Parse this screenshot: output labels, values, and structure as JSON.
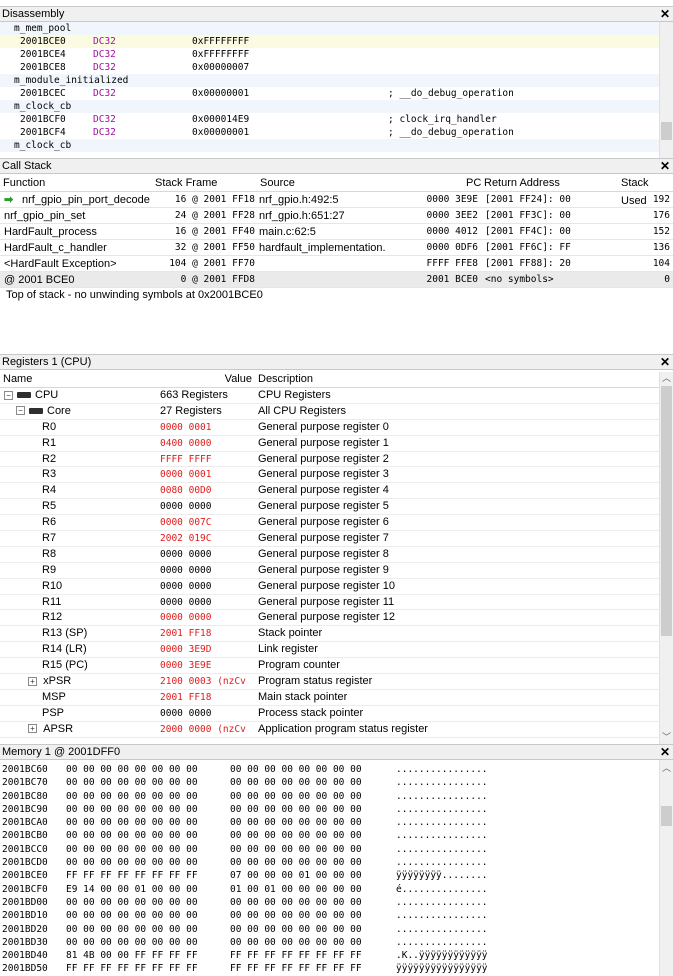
{
  "disassembly": {
    "title": "Disassembly",
    "close": "✕",
    "lines": [
      {
        "kind": "sym",
        "text": "m_mem_pool"
      },
      {
        "kind": "cur",
        "addr": "2001BCE0",
        "op": "DC32",
        "val": "0xFFFFFFFF",
        "cmt": ""
      },
      {
        "kind": "code",
        "addr": "2001BCE4",
        "op": "DC32",
        "val": "0xFFFFFFFF",
        "cmt": ""
      },
      {
        "kind": "code",
        "addr": "2001BCE8",
        "op": "DC32",
        "val": "0x00000007",
        "cmt": ""
      },
      {
        "kind": "sym",
        "text": "m_module_initialized"
      },
      {
        "kind": "code",
        "addr": "2001BCEC",
        "op": "DC32",
        "val": "0x00000001",
        "cmt": "; __do_debug_operation"
      },
      {
        "kind": "sym",
        "text": "m_clock_cb"
      },
      {
        "kind": "code",
        "addr": "2001BCF0",
        "op": "DC32",
        "val": "0x000014E9",
        "cmt": "; clock_irq_handler"
      },
      {
        "kind": "code",
        "addr": "2001BCF4",
        "op": "DC32",
        "val": "0x00000001",
        "cmt": "; __do_debug_operation"
      },
      {
        "kind": "sym",
        "text": "m_clock_cb"
      }
    ]
  },
  "callstack": {
    "title": "Call Stack",
    "close": "✕",
    "headers": {
      "function": "Function",
      "frame": "Stack Frame",
      "source": "Source",
      "pc": "PC",
      "ret": "Return Address",
      "used": "Stack Used"
    },
    "rows": [
      {
        "function": "nrf_gpio_pin_port_decode",
        "frame": "16 @ 2001 FF18",
        "source": "nrf_gpio.h:492:5",
        "pc": "0000 3E9E",
        "ret": "[2001 FF24]: 00",
        "used": "192",
        "current": true
      },
      {
        "function": "nrf_gpio_pin_set",
        "frame": "24 @ 2001 FF28",
        "source": "nrf_gpio.h:651:27",
        "pc": "0000 3EE2",
        "ret": "[2001 FF3C]: 00",
        "used": "176"
      },
      {
        "function": "HardFault_process",
        "frame": "16 @ 2001 FF40",
        "source": "main.c:62:5",
        "pc": "0000 4012",
        "ret": "[2001 FF4C]: 00",
        "used": "152"
      },
      {
        "function": "HardFault_c_handler",
        "frame": "32 @ 2001 FF50",
        "source": "hardfault_implementation.c:",
        "pc": "0000 0DF6",
        "ret": "[2001 FF6C]: FF",
        "used": "136"
      },
      {
        "function": "<HardFault Exception>",
        "frame": "104 @ 2001 FF70",
        "source": "",
        "pc": "FFFF FFE8",
        "ret": "[2001 FF88]: 20",
        "used": "104"
      },
      {
        "function": "@ 2001 BCE0",
        "frame": "0 @ 2001 FFD8",
        "source": "",
        "pc": "2001 BCE0",
        "ret": "<no symbols>",
        "used": "0"
      }
    ],
    "note": "Top of stack - no unwinding symbols at 0x2001BCE0"
  },
  "registers": {
    "title": "Registers 1 (CPU)",
    "close": "✕",
    "headers": {
      "name": "Name",
      "value": "Value",
      "desc": "Description"
    },
    "rows": [
      {
        "name": "CPU",
        "value": "663 Registers",
        "desc": "CPU Registers",
        "level": 0,
        "expander": "−",
        "chip": true,
        "red": false
      },
      {
        "name": "Core",
        "value": "27 Registers",
        "desc": "All CPU Registers",
        "level": 1,
        "expander": "−",
        "chip": true,
        "red": false
      },
      {
        "name": "R0",
        "value": "0000 0001",
        "desc": "General purpose register 0",
        "level": 2,
        "red": true
      },
      {
        "name": "R1",
        "value": "0400 0000",
        "desc": "General purpose register 1",
        "level": 2,
        "red": true
      },
      {
        "name": "R2",
        "value": "FFFF FFFF",
        "desc": "General purpose register 2",
        "level": 2,
        "red": true
      },
      {
        "name": "R3",
        "value": "0000 0001",
        "desc": "General purpose register 3",
        "level": 2,
        "red": true
      },
      {
        "name": "R4",
        "value": "0080 00D0",
        "desc": "General purpose register 4",
        "level": 2,
        "red": true
      },
      {
        "name": "R5",
        "value": "0000 0000",
        "desc": "General purpose register 5",
        "level": 2,
        "red": false
      },
      {
        "name": "R6",
        "value": "0000 007C",
        "desc": "General purpose register 6",
        "level": 2,
        "red": true
      },
      {
        "name": "R7",
        "value": "2002 019C",
        "desc": "General purpose register 7",
        "level": 2,
        "red": true
      },
      {
        "name": "R8",
        "value": "0000 0000",
        "desc": "General purpose register 8",
        "level": 2,
        "red": false
      },
      {
        "name": "R9",
        "value": "0000 0000",
        "desc": "General purpose register 9",
        "level": 2,
        "red": false
      },
      {
        "name": "R10",
        "value": "0000 0000",
        "desc": "General purpose register 10",
        "level": 2,
        "red": false
      },
      {
        "name": "R11",
        "value": "0000 0000",
        "desc": "General purpose register 11",
        "level": 2,
        "red": false
      },
      {
        "name": "R12",
        "value": "0000 0000",
        "desc": "General purpose register 12",
        "level": 2,
        "red": true
      },
      {
        "name": "R13 (SP)",
        "value": "2001 FF18",
        "desc": "Stack pointer",
        "level": 2,
        "red": true
      },
      {
        "name": "R14 (LR)",
        "value": "0000 3E9D",
        "desc": "Link register",
        "level": 2,
        "red": true
      },
      {
        "name": "R15 (PC)",
        "value": "0000 3E9E",
        "desc": "Program counter",
        "level": 2,
        "red": true
      },
      {
        "name": "xPSR",
        "value": "2100 0003  (nzCv",
        "desc": "Program status register",
        "level": 2,
        "expander": "+",
        "red": true
      },
      {
        "name": "MSP",
        "value": "2001 FF18",
        "desc": "Main stack pointer",
        "level": 2,
        "red": true
      },
      {
        "name": "PSP",
        "value": "0000 0000",
        "desc": "Process stack pointer",
        "level": 2,
        "red": false
      },
      {
        "name": "APSR",
        "value": "2000 0000  (nzCv",
        "desc": "Application program status register",
        "level": 2,
        "expander": "+",
        "red": true
      }
    ]
  },
  "memory": {
    "title": "Memory 1 @ 2001DFF0",
    "close": "✕",
    "rows": [
      {
        "addr": "2001BC60",
        "bytes1": "00 00 00 00 00 00 00 00",
        "bytes2": "00 00 00 00 00 00 00 00",
        "ascii": "................"
      },
      {
        "addr": "2001BC70",
        "bytes1": "00 00 00 00 00 00 00 00",
        "bytes2": "00 00 00 00 00 00 00 00",
        "ascii": "................"
      },
      {
        "addr": "2001BC80",
        "bytes1": "00 00 00 00 00 00 00 00",
        "bytes2": "00 00 00 00 00 00 00 00",
        "ascii": "................"
      },
      {
        "addr": "2001BC90",
        "bytes1": "00 00 00 00 00 00 00 00",
        "bytes2": "00 00 00 00 00 00 00 00",
        "ascii": "................"
      },
      {
        "addr": "2001BCA0",
        "bytes1": "00 00 00 00 00 00 00 00",
        "bytes2": "00 00 00 00 00 00 00 00",
        "ascii": "................"
      },
      {
        "addr": "2001BCB0",
        "bytes1": "00 00 00 00 00 00 00 00",
        "bytes2": "00 00 00 00 00 00 00 00",
        "ascii": "................"
      },
      {
        "addr": "2001BCC0",
        "bytes1": "00 00 00 00 00 00 00 00",
        "bytes2": "00 00 00 00 00 00 00 00",
        "ascii": "................"
      },
      {
        "addr": "2001BCD0",
        "bytes1": "00 00 00 00 00 00 00 00",
        "bytes2": "00 00 00 00 00 00 00 00",
        "ascii": "................"
      },
      {
        "addr": "2001BCE0",
        "bytes1": "FF FF FF FF FF FF FF FF",
        "bytes2": "07 00 00 00 01 00 00 00",
        "ascii": "ÿÿÿÿÿÿÿÿ........"
      },
      {
        "addr": "2001BCF0",
        "bytes1": "E9 14 00 00 01 00 00 00",
        "bytes2": "01 00 01 00 00 00 00 00",
        "ascii": "é..............."
      },
      {
        "addr": "2001BD00",
        "bytes1": "00 00 00 00 00 00 00 00",
        "bytes2": "00 00 00 00 00 00 00 00",
        "ascii": "................"
      },
      {
        "addr": "2001BD10",
        "bytes1": "00 00 00 00 00 00 00 00",
        "bytes2": "00 00 00 00 00 00 00 00",
        "ascii": "................"
      },
      {
        "addr": "2001BD20",
        "bytes1": "00 00 00 00 00 00 00 00",
        "bytes2": "00 00 00 00 00 00 00 00",
        "ascii": "................"
      },
      {
        "addr": "2001BD30",
        "bytes1": "00 00 00 00 00 00 00 00",
        "bytes2": "00 00 00 00 00 00 00 00",
        "ascii": "................"
      },
      {
        "addr": "2001BD40",
        "bytes1": "81 4B 00 00 FF FF FF FF",
        "bytes2": "FF FF FF FF FF FF FF FF",
        "ascii": ".K..ÿÿÿÿÿÿÿÿÿÿÿÿ"
      },
      {
        "addr": "2001BD50",
        "bytes1": "FF FF FF FF FF FF FF FF",
        "bytes2": "FF FF FF FF FF FF FF FF",
        "ascii": "ÿÿÿÿÿÿÿÿÿÿÿÿÿÿÿÿ"
      }
    ]
  }
}
